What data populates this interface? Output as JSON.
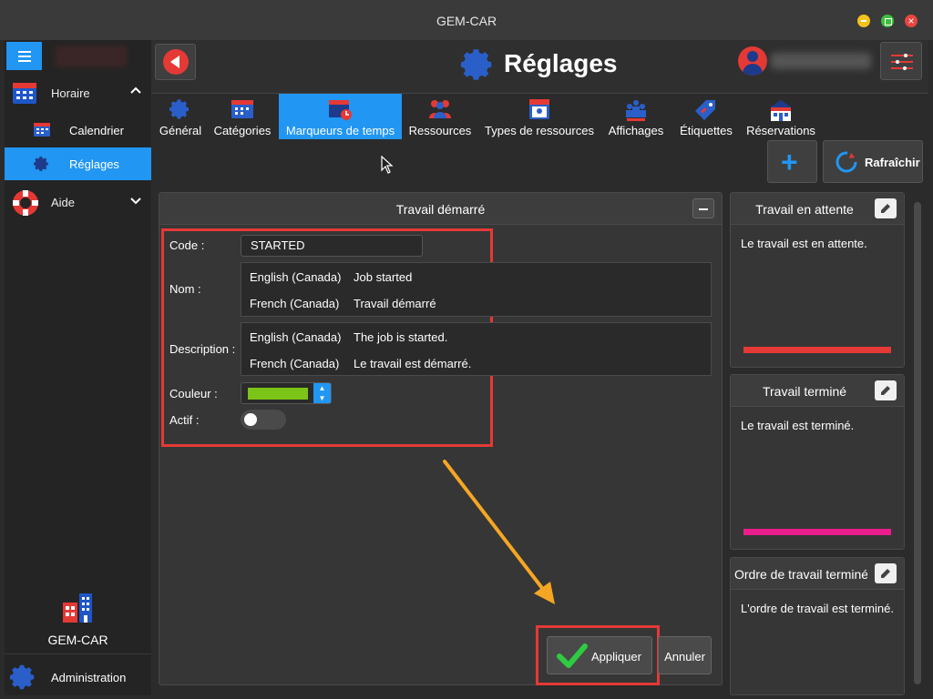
{
  "window": {
    "title": "GEM-CAR"
  },
  "sidebar": {
    "groups": [
      {
        "label": "Horaire",
        "icon": "calendar-grid-icon"
      },
      {
        "label": "Aide",
        "icon": "lifebuoy-icon"
      }
    ],
    "items": [
      {
        "label": "Calendrier",
        "icon": "calendar-icon"
      },
      {
        "label": "Réglages",
        "icon": "gear-icon",
        "active": true
      }
    ],
    "brand": "GEM-CAR",
    "admin_label": "Administration"
  },
  "header": {
    "title": "Réglages"
  },
  "tabs": [
    {
      "label": "Général",
      "icon": "gear-icon"
    },
    {
      "label": "Catégories",
      "icon": "calendar-icon"
    },
    {
      "label": "Marqueurs de temps",
      "icon": "calendar-clock-icon",
      "active": true
    },
    {
      "label": "Ressources",
      "icon": "people-icon"
    },
    {
      "label": "Types de ressources",
      "icon": "id-card-icon"
    },
    {
      "label": "Affichages",
      "icon": "display-icon"
    },
    {
      "label": "Étiquettes",
      "icon": "tag-icon"
    },
    {
      "label": "Réservations",
      "icon": "building-icon"
    }
  ],
  "toolbar": {
    "refresh_label": "Rafraîchir",
    "add_symbol": "+"
  },
  "form": {
    "title": "Travail démarré",
    "code_label": "Code :",
    "code_value": "STARTED",
    "name_label": "Nom :",
    "names": [
      {
        "lang": "English (Canada)",
        "value": "Job started"
      },
      {
        "lang": "French (Canada)",
        "value": "Travail démarré"
      }
    ],
    "description_label": "Description :",
    "descriptions": [
      {
        "lang": "English (Canada)",
        "value": "The job is started."
      },
      {
        "lang": "French (Canada)",
        "value": "Le travail est démarré."
      }
    ],
    "color_label": "Couleur :",
    "color_value": "#7cc417",
    "active_label": "Actif :",
    "active": false,
    "apply_label": "Appliquer",
    "cancel_label": "Annuler"
  },
  "side_cards": [
    {
      "title": "Travail en attente",
      "desc": "Le travail est en attente.",
      "color": "#e53935"
    },
    {
      "title": "Travail terminé",
      "desc": "Le travail est terminé.",
      "color": "#e91e8c"
    },
    {
      "title": "Ordre de travail terminé",
      "desc": "L'ordre de travail est terminé."
    }
  ],
  "colors": {
    "accent": "#2196f3",
    "highlight": "#e53935",
    "arrow": "#f5a623"
  }
}
